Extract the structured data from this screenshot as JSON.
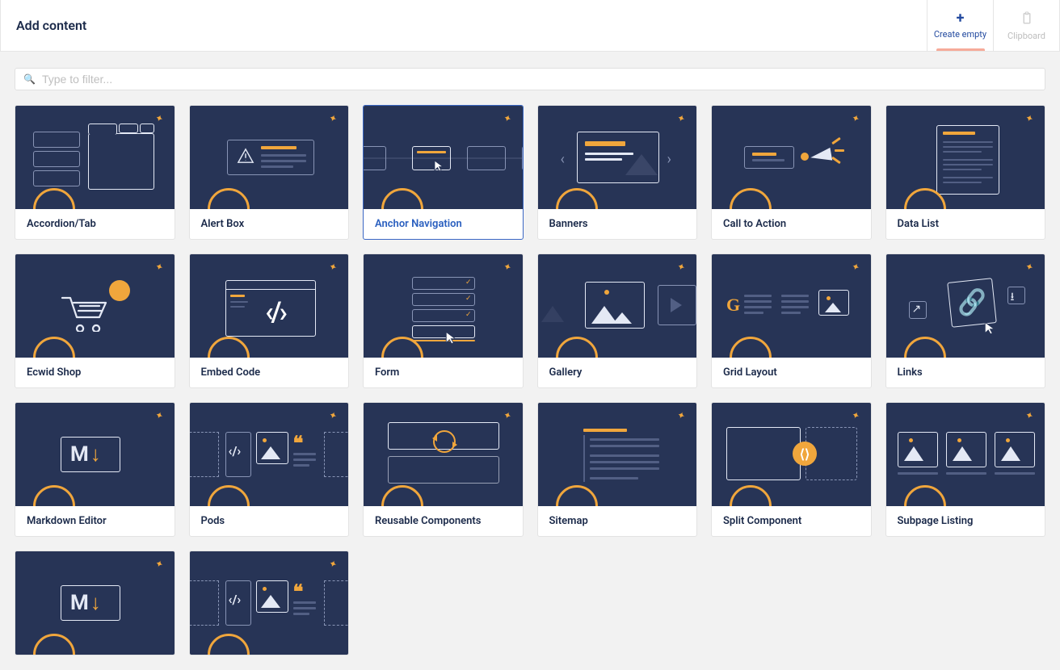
{
  "header": {
    "title": "Add content",
    "create_label": "Create empty",
    "clipboard_label": "Clipboard"
  },
  "filter": {
    "placeholder": "Type to filter..."
  },
  "items": [
    {
      "id": "accordion-tab",
      "label": "Accordion/Tab",
      "selected": false,
      "thumb": "accordion"
    },
    {
      "id": "alert-box",
      "label": "Alert Box",
      "selected": false,
      "thumb": "alert"
    },
    {
      "id": "anchor-navigation",
      "label": "Anchor Navigation",
      "selected": true,
      "thumb": "anchor"
    },
    {
      "id": "banners",
      "label": "Banners",
      "selected": false,
      "thumb": "banners"
    },
    {
      "id": "call-to-action",
      "label": "Call to Action",
      "selected": false,
      "thumb": "cta"
    },
    {
      "id": "data-list",
      "label": "Data List",
      "selected": false,
      "thumb": "datalist"
    },
    {
      "id": "ecwid-shop",
      "label": "Ecwid Shop",
      "selected": false,
      "thumb": "ecwid"
    },
    {
      "id": "embed-code",
      "label": "Embed Code",
      "selected": false,
      "thumb": "embed"
    },
    {
      "id": "form",
      "label": "Form",
      "selected": false,
      "thumb": "form"
    },
    {
      "id": "gallery",
      "label": "Gallery",
      "selected": false,
      "thumb": "gallery"
    },
    {
      "id": "grid-layout",
      "label": "Grid Layout",
      "selected": false,
      "thumb": "grid"
    },
    {
      "id": "links",
      "label": "Links",
      "selected": false,
      "thumb": "links"
    },
    {
      "id": "markdown-editor",
      "label": "Markdown Editor",
      "selected": false,
      "thumb": "md"
    },
    {
      "id": "pods",
      "label": "Pods",
      "selected": false,
      "thumb": "pods"
    },
    {
      "id": "reusable-components",
      "label": "Reusable Components",
      "selected": false,
      "thumb": "reuse"
    },
    {
      "id": "sitemap",
      "label": "Sitemap",
      "selected": false,
      "thumb": "sitemap"
    },
    {
      "id": "split-component",
      "label": "Split Component",
      "selected": false,
      "thumb": "split"
    },
    {
      "id": "subpage-listing",
      "label": "Subpage Listing",
      "selected": false,
      "thumb": "sub"
    },
    {
      "id": "extra-1",
      "label": "",
      "selected": false,
      "thumb": "md"
    },
    {
      "id": "extra-2",
      "label": "",
      "selected": false,
      "thumb": "pods"
    }
  ]
}
